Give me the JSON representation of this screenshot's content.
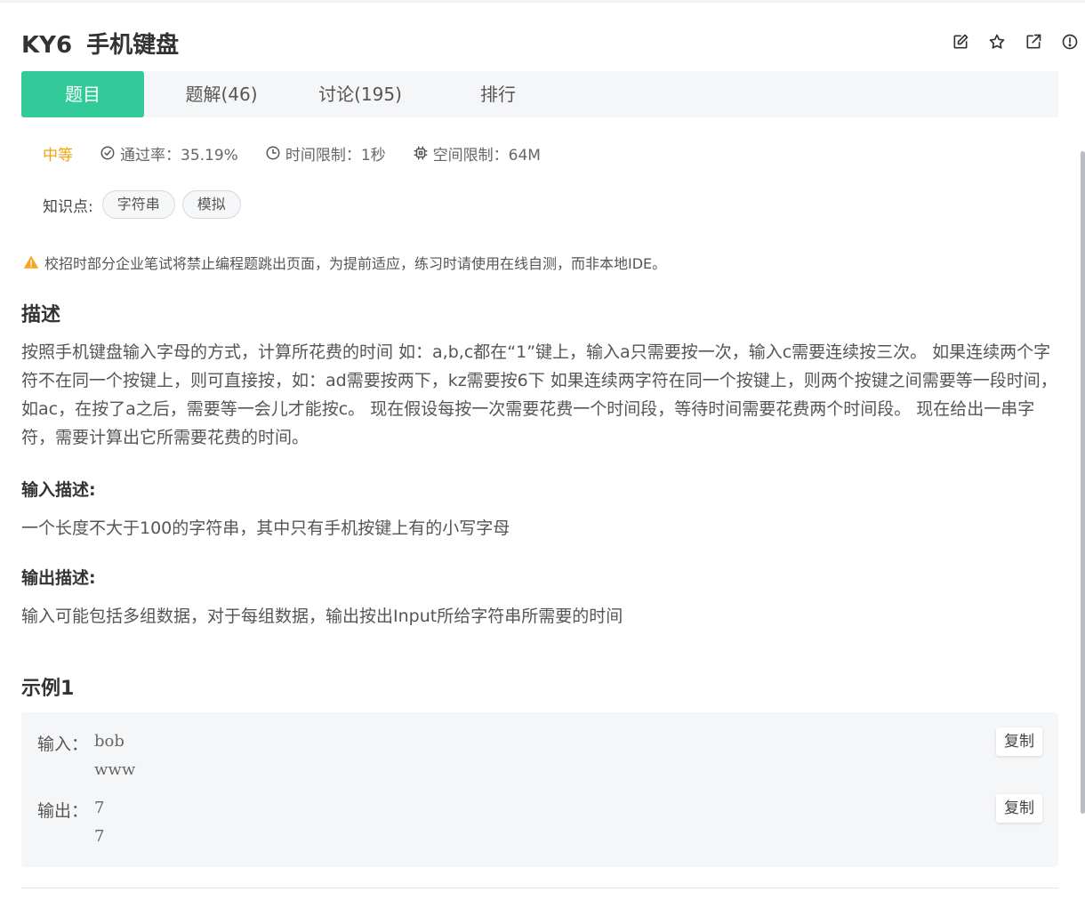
{
  "header": {
    "problem_code": "KY6",
    "problem_title": "手机键盘",
    "icons": [
      "edit-icon",
      "star-icon",
      "external-link-icon",
      "report-icon"
    ]
  },
  "tabs": [
    {
      "label": "题目",
      "active": true
    },
    {
      "label": "题解(46)",
      "active": false
    },
    {
      "label": "讨论(195)",
      "active": false
    },
    {
      "label": "排行",
      "active": false
    }
  ],
  "meta": {
    "difficulty": "中等",
    "pass_rate": "通过率：35.19%",
    "time_limit": "时间限制：1秒",
    "memory_limit": "空间限制：64M"
  },
  "knowledge": {
    "label": "知识点:",
    "tags": [
      "字符串",
      "模拟"
    ]
  },
  "warning": "校招时部分企业笔试将禁止编程题跳出页面，为提前适应，练习时请使用在线自测，而非本地IDE。",
  "description": {
    "heading": "描述",
    "text": "按照手机键盘输入字母的方式，计算所花费的时间 如：a,b,c都在“1”键上，输入a只需要按一次，输入c需要连续按三次。 如果连续两个字符不在同一个按键上，则可直接按，如：ad需要按两下，kz需要按6下 如果连续两字符在同一个按键上，则两个按键之间需要等一段时间，如ac，在按了a之后，需要等一会儿才能按c。 现在假设每按一次需要花费一个时间段，等待时间需要花费两个时间段。 现在给出一串字符，需要计算出它所需要花费的时间。"
  },
  "input_desc": {
    "heading": "输入描述:",
    "text": "一个长度不大于100的字符串，其中只有手机按键上有的小写字母"
  },
  "output_desc": {
    "heading": "输出描述:",
    "text": "输入可能包括多组数据，对于每组数据，输出按出Input所给字符串所需要的时间"
  },
  "example": {
    "heading": "示例1",
    "input_label": "输入：",
    "input_lines": [
      "bob",
      "www"
    ],
    "output_label": "输出：",
    "output_lines": [
      "7",
      "7"
    ],
    "copy_label": "复制"
  },
  "colors": {
    "accent": "#32ca99",
    "difficulty": "#f0a30a",
    "warning_icon": "#f5a623"
  }
}
